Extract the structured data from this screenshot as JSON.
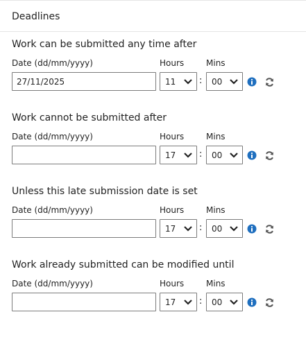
{
  "section": {
    "title": "Deadlines"
  },
  "labels": {
    "date": "Date (dd/mm/yyyy)",
    "hours": "Hours",
    "mins": "Mins"
  },
  "separator": ":",
  "icons": {
    "info": "info-icon",
    "refresh": "refresh-icon",
    "chevron": "chevron-down-icon",
    "info_color": "#1f6fbf",
    "refresh_color": "#555555"
  },
  "groups": [
    {
      "title": "Work can be submitted any time after",
      "date_value": "27/11/2025",
      "hours_value": "11",
      "mins_value": "00"
    },
    {
      "title": "Work cannot be submitted after",
      "date_value": "",
      "hours_value": "17",
      "mins_value": "00"
    },
    {
      "title": "Unless this late submission date is set",
      "date_value": "",
      "hours_value": "17",
      "mins_value": "00"
    },
    {
      "title": "Work already submitted can be modified until",
      "date_value": "",
      "hours_value": "17",
      "mins_value": "00"
    }
  ]
}
